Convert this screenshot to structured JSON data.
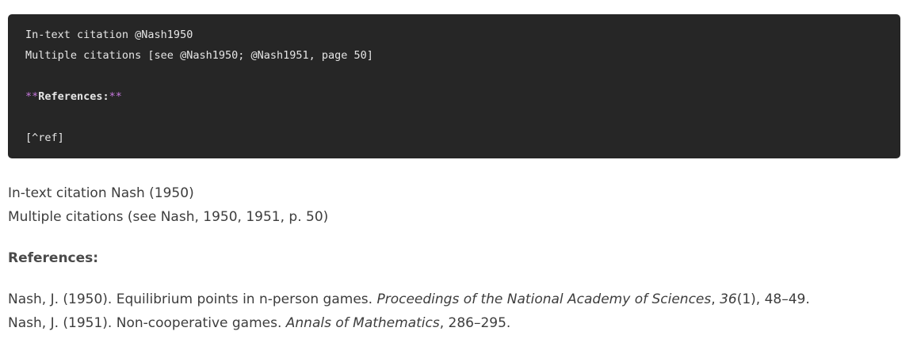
{
  "source": {
    "line1": "In-text citation @Nash1950",
    "line2": "Multiple citations [see @Nash1950; @Nash1951, page 50]",
    "references_open_marker": "**",
    "references_text": "References:",
    "references_close_marker": "**",
    "ref_placeholder": "[^ref]"
  },
  "preview": {
    "line1": "In-text citation Nash (1950)",
    "line2": "Multiple citations (see Nash, 1950, 1951, p. 50)",
    "references_heading": "References:",
    "refs": [
      {
        "prefix": "Nash, J. (1950). Equilibrium points in n-person games. ",
        "journal": "Proceedings of the National Academy of Sciences",
        "sep": ", ",
        "volume": "36",
        "rest": "(1), 48–49."
      },
      {
        "prefix": "Nash, J. (1951). Non-cooperative games. ",
        "journal": "Annals of Mathematics",
        "rest": ", 286–295."
      }
    ]
  },
  "colors": {
    "code_background": "#262626",
    "code_text": "#e6e6e6",
    "markdown_marker": "#c678dd",
    "preview_text": "#3d3d3d"
  }
}
